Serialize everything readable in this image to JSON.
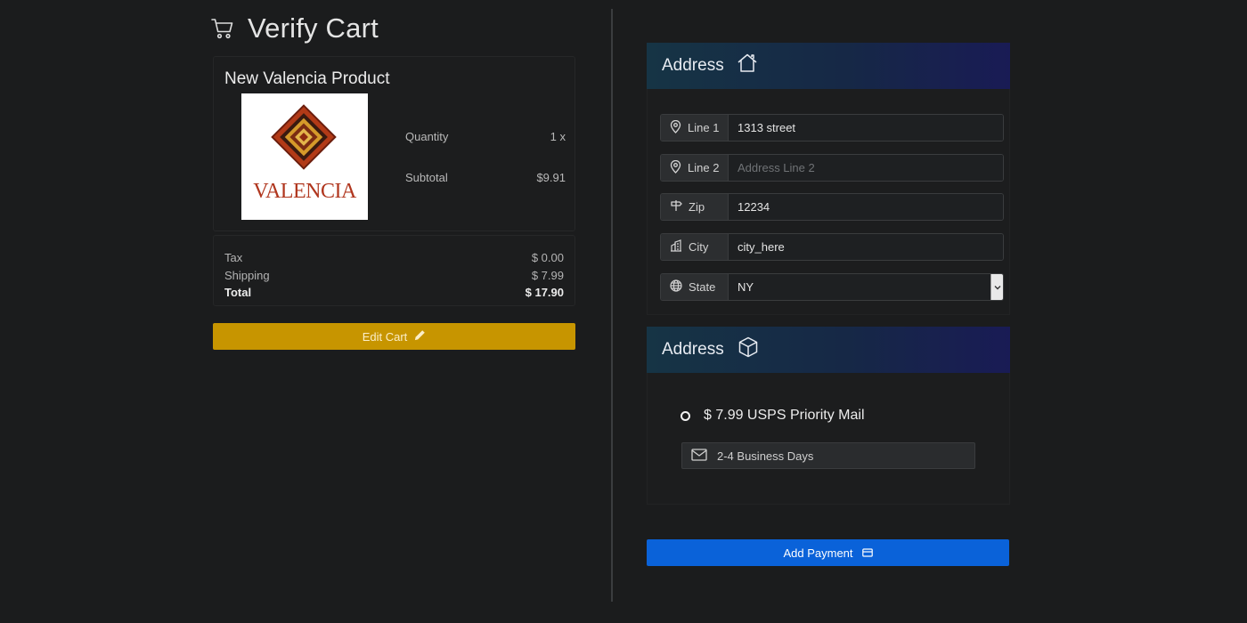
{
  "header": {
    "title": "Verify Cart",
    "icon": "cart-icon"
  },
  "product": {
    "name": "New Valencia Product",
    "image_text": "VALENCIA",
    "quantity_label": "Quantity",
    "quantity_value": "1 x",
    "subtotal_label": "Subtotal",
    "subtotal_value": "$9.91"
  },
  "totals": {
    "tax_label": "Tax",
    "tax_value": "$ 0.00",
    "shipping_label": "Shipping",
    "shipping_value": "$ 7.99",
    "total_label": "Total",
    "total_value": "$ 17.90"
  },
  "edit_cart": {
    "label": "Edit Cart",
    "icon": "pencil-icon",
    "color": "#c79500"
  },
  "address_section": {
    "title": "Address",
    "icon": "house-icon",
    "fields": [
      {
        "label": "Line 1",
        "icon": "map-pin-icon",
        "value": "1313 street",
        "placeholder": ""
      },
      {
        "label": "Line 2",
        "icon": "map-pin-icon",
        "value": "",
        "placeholder": "Address Line 2"
      },
      {
        "label": "Zip",
        "icon": "signpost-icon",
        "value": "12234",
        "placeholder": ""
      },
      {
        "label": "City",
        "icon": "buildings-icon",
        "value": "city_here",
        "placeholder": ""
      },
      {
        "label": "State",
        "icon": "globe-icon",
        "value": "NY"
      }
    ]
  },
  "shipping_section": {
    "title": "Address",
    "icon": "box-icon",
    "option_label": "$ 7.99 USPS Priority Mail",
    "delivery_time": "2-4 Business Days",
    "delivery_icon": "envelope-icon"
  },
  "add_payment": {
    "label": "Add Payment",
    "icon": "credit-card-icon",
    "color": "#0a62d9"
  }
}
